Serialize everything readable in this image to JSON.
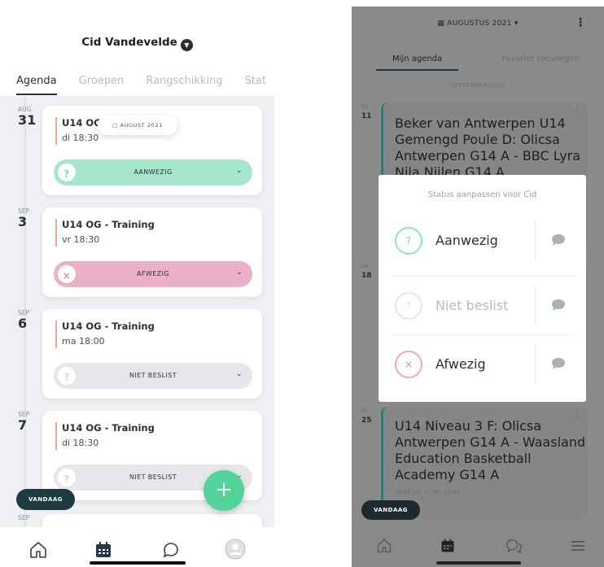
{
  "left": {
    "header": {
      "user_name": "Cid Vandevelde"
    },
    "tabs": [
      {
        "label": "Agenda"
      },
      {
        "label": "Groepen"
      },
      {
        "label": "Rangschikking"
      },
      {
        "label": "Stat"
      }
    ],
    "floating_month_chip": "AUGUST 2021",
    "events": [
      {
        "month": "AUG",
        "day": "31",
        "title": "U14 OG",
        "time": "di 18:30",
        "status": "AANWEZIG"
      },
      {
        "month": "SEP",
        "day": "3",
        "title": "U14 OG - Training",
        "time": "vr 18:30",
        "status": "AFWEZIG"
      },
      {
        "month": "SEP",
        "day": "6",
        "title": "U14 OG - Training",
        "time": "ma 18:00",
        "status": "NIET BESLIST"
      },
      {
        "month": "SEP",
        "day": "7",
        "title": "U14 OG - Training",
        "time": "di 18:30",
        "status": "NIET BESLIST"
      }
    ],
    "next_month_peek": "SEP",
    "today_button": "VANDAAG",
    "fab_label": "+",
    "colors": {
      "aanwezig": "#a6e6cc",
      "afwezig": "#eab0c7",
      "niet_beslist": "#e5e7eb",
      "fab": "#52d39a",
      "accent_bar": "#f0a894"
    },
    "nav_icons": [
      "home-icon",
      "calendar-icon",
      "chat-icon",
      "profile-icon"
    ]
  },
  "right": {
    "month_header": "AUGUSTUS 2021",
    "tabs": [
      {
        "label": "Mijn agenda"
      },
      {
        "label": "Favoriet toevoegen"
      }
    ],
    "month_separator": "SEPTEMBER 2021",
    "events": [
      {
        "weekday": "ZA",
        "day": "11",
        "title": "Beker van Antwerpen U14 Gemengd Poule D: Olicsa Antwerpen G14 A - BBC Lyra Nila Nijlen G14 A"
      },
      {
        "weekday": "ZA",
        "day": "18",
        "title": ""
      },
      {
        "weekday": "ZA",
        "day": "25",
        "title": "U14 Niveau 3 F: Olicsa Antwerpen G14 A - Waasland Education Basketball Academy G14 A",
        "subtitle": "ZA 25 SEP 13:00 - 15:00"
      }
    ],
    "modal": {
      "title": "Status aanpassen voor Cid",
      "options": [
        {
          "label": "Aanwezig",
          "symbol": "?",
          "color": "#7ed9b5"
        },
        {
          "label": "Niet beslist",
          "symbol": "?",
          "color": "#e2e4e8"
        },
        {
          "label": "Afwezig",
          "symbol": "×",
          "color": "#e58fb0"
        }
      ]
    },
    "today_button": "VANDAAG",
    "nav_icons": [
      "home-icon",
      "calendar-icon",
      "chat-icon",
      "menu-icon"
    ]
  }
}
